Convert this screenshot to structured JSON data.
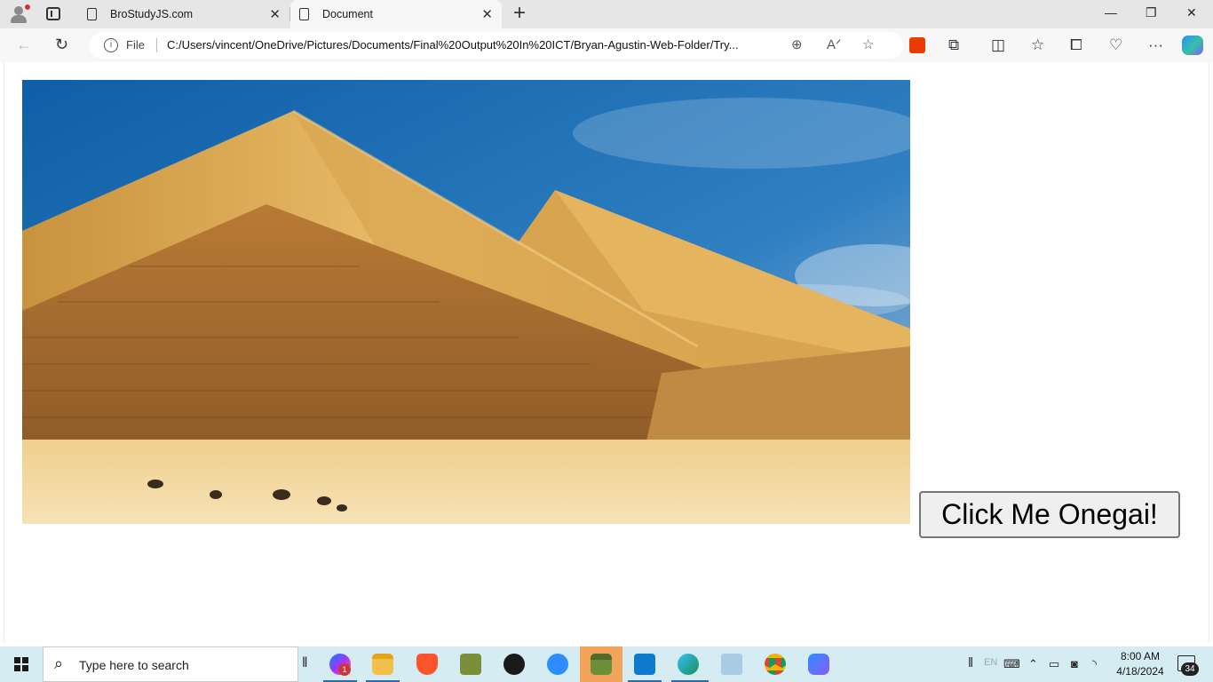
{
  "browser": {
    "tabs": [
      {
        "title": "BroStudyJS.com",
        "active": false
      },
      {
        "title": "Document",
        "active": true
      }
    ],
    "address": {
      "scheme_label": "File",
      "url": "C:/Users/vincent/OneDrive/Pictures/Documents/Final%20Output%20In%20ICT/Bryan-Agustin-Web-Folder/Try..."
    },
    "icons": {
      "back": "arrow-left-icon",
      "refresh": "refresh-icon",
      "zoom": "zoom-icon",
      "read_aloud": "read-aloud-icon",
      "favorite": "star-icon",
      "extensions": "puzzle-icon",
      "split": "split-screen-icon",
      "favorites": "favorites-icon",
      "collections": "collections-icon",
      "health": "browser-essentials-icon",
      "menu": "more-icon"
    },
    "window_controls": {
      "minimize": "—",
      "restore": "❐",
      "close": "✕"
    }
  },
  "page": {
    "image": {
      "subject": "pyramids-of-giza"
    },
    "button": {
      "label": "Click Me Onegai!"
    }
  },
  "taskbar": {
    "search_placeholder": "Type here to search",
    "messenger_badge": "1",
    "clock": {
      "time": "8:00 AM",
      "date": "4/18/2024"
    },
    "notifications_count": "34",
    "apps": [
      "messenger",
      "file-explorer",
      "brave",
      "game",
      "app-red",
      "zoom",
      "minecraft",
      "vs-code",
      "edge",
      "notepad",
      "chrome",
      "copilot"
    ]
  },
  "colors": {
    "sky": "#1f6fb3",
    "sand": "#e7b863",
    "taskbar": "#d6ecf3",
    "accent": "#2b6cb0"
  }
}
